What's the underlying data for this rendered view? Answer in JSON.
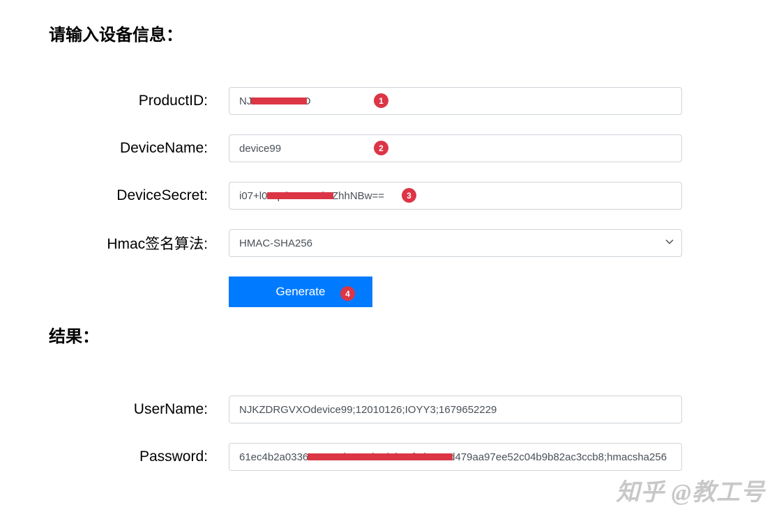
{
  "sections": {
    "input_title": "请输入设备信息：",
    "result_title": "结果："
  },
  "labels": {
    "product_id": "ProductID:",
    "device_name": "DeviceName:",
    "device_secret": "DeviceSecret:",
    "hmac_algo": "Hmac签名算法:",
    "username": "UserName:",
    "password": "Password:"
  },
  "values": {
    "product_id": "NJKZDRGVXO",
    "device_name": "device99",
    "device_secret": "i07+l0Tq0kFYHBdHZhhNBw==",
    "hmac_algo": "HMAC-SHA256",
    "username": "NJKZDRGVXOdevice99;12010126;IOYY3;1679652229",
    "password": "61ec4b2a0336077917b4c10b4dabc0fcd2424d479aa97ee52c04b9b82ac3ccb8;hmacsha256"
  },
  "button": {
    "generate": "Generate"
  },
  "callouts": {
    "c1": "1",
    "c2": "2",
    "c3": "3",
    "c4": "4"
  },
  "watermark": "知乎 @教工号"
}
